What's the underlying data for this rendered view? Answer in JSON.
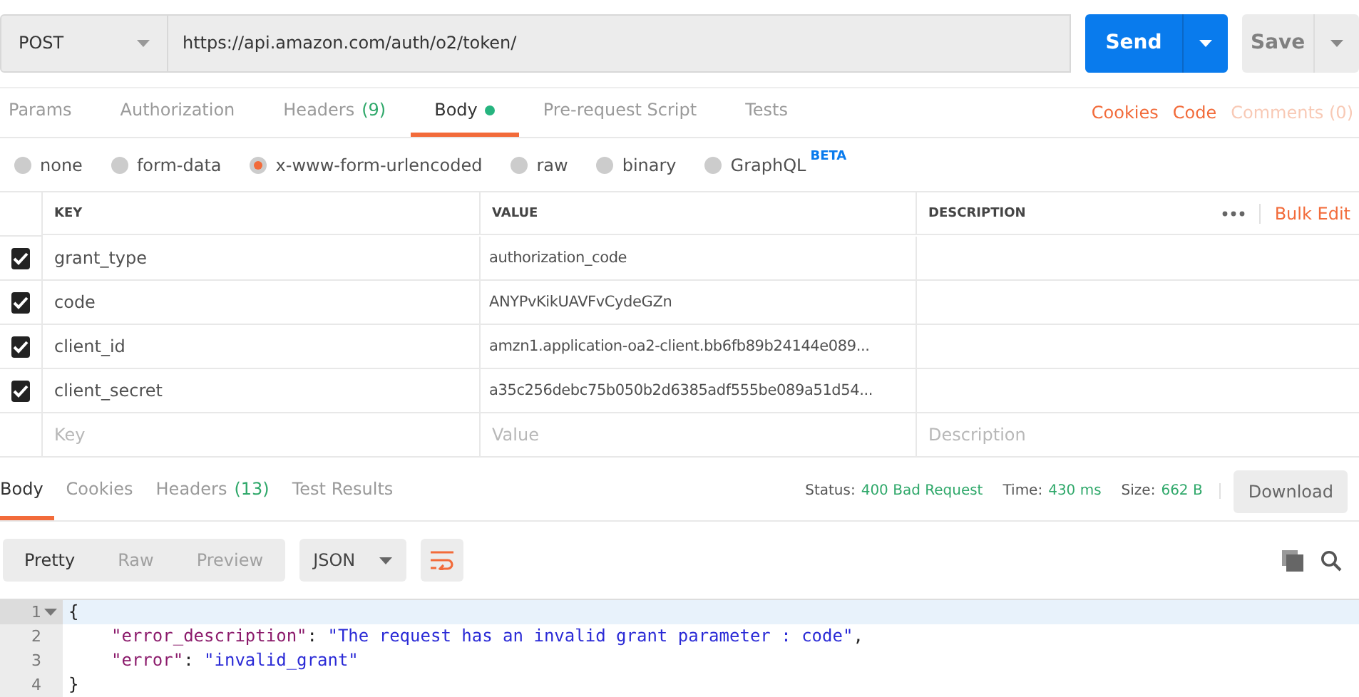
{
  "request": {
    "method": "POST",
    "url": "https://api.amazon.com/auth/o2/token/",
    "send": "Send",
    "save": "Save"
  },
  "tabs": [
    {
      "label": "Params",
      "selected": false,
      "dot": false
    },
    {
      "label": "Authorization",
      "selected": false,
      "dot": false
    },
    {
      "label": "Headers",
      "count": "(9)",
      "selected": false,
      "dot": false
    },
    {
      "label": "Body",
      "selected": true,
      "dot": true
    },
    {
      "label": "Pre-request Script",
      "selected": false,
      "dot": false
    },
    {
      "label": "Tests",
      "selected": false,
      "dot": false
    }
  ],
  "tab_links": [
    {
      "label": "Cookies",
      "disabled": false
    },
    {
      "label": "Code",
      "disabled": false
    },
    {
      "label": "Comments (0)",
      "disabled": true
    }
  ],
  "body_types": [
    {
      "label": "none",
      "selected": false
    },
    {
      "label": "form-data",
      "selected": false
    },
    {
      "label": "x-www-form-urlencoded",
      "selected": true
    },
    {
      "label": "raw",
      "selected": false
    },
    {
      "label": "binary",
      "selected": false
    },
    {
      "label": "GraphQL",
      "selected": false,
      "badge": "BETA"
    }
  ],
  "table": {
    "columns": [
      "KEY",
      "VALUE",
      "DESCRIPTION"
    ],
    "bulk_edit": "Bulk Edit",
    "rows": [
      {
        "checked": true,
        "key": "grant_type",
        "value": "authorization_code"
      },
      {
        "checked": true,
        "key": "code",
        "value": "ANYPvKikUAVFvCydeGZn"
      },
      {
        "checked": true,
        "key": "client_id",
        "value": "amzn1.application-oa2-client.bb6fb89b24144e089..."
      },
      {
        "checked": true,
        "key": "client_secret",
        "value": "a35c256debc75b050b2d6385adf555be089a51d54..."
      }
    ],
    "placeholders": [
      "Key",
      "Value",
      "Description"
    ]
  },
  "response_tabs": [
    {
      "label": "Body",
      "selected": true
    },
    {
      "label": "Cookies",
      "selected": false
    },
    {
      "label": "Headers",
      "count": "(13)",
      "selected": false
    },
    {
      "label": "Test Results",
      "selected": false
    }
  ],
  "status": [
    {
      "label": "Status:",
      "value": "400 Bad Request"
    },
    {
      "label": "Time:",
      "value": "430 ms"
    },
    {
      "label": "Size:",
      "value": "662 B"
    }
  ],
  "download": "Download",
  "view_modes": [
    {
      "label": "Pretty",
      "selected": true
    },
    {
      "label": "Raw",
      "selected": false
    },
    {
      "label": "Preview",
      "selected": false
    }
  ],
  "format": "JSON",
  "code": [
    {
      "number": "1",
      "selected": true,
      "fold": true,
      "tokens": [
        {
          "kind": "punct",
          "text": "{"
        }
      ]
    },
    {
      "number": "2",
      "selected": false,
      "fold": false,
      "tokens": [
        {
          "kind": "key",
          "text": "\"error_description\""
        },
        {
          "kind": "punct",
          "text": ": "
        },
        {
          "kind": "string",
          "text": "\"The request has an invalid grant parameter : code\""
        },
        {
          "kind": "punct",
          "text": ","
        }
      ]
    },
    {
      "number": "3",
      "selected": false,
      "fold": false,
      "tokens": [
        {
          "kind": "key",
          "text": "\"error\""
        },
        {
          "kind": "punct",
          "text": ": "
        },
        {
          "kind": "string",
          "text": "\"invalid_grant\""
        }
      ]
    },
    {
      "number": "4",
      "selected": false,
      "fold": false,
      "tokens": [
        {
          "kind": "punct",
          "text": "}"
        }
      ]
    }
  ]
}
